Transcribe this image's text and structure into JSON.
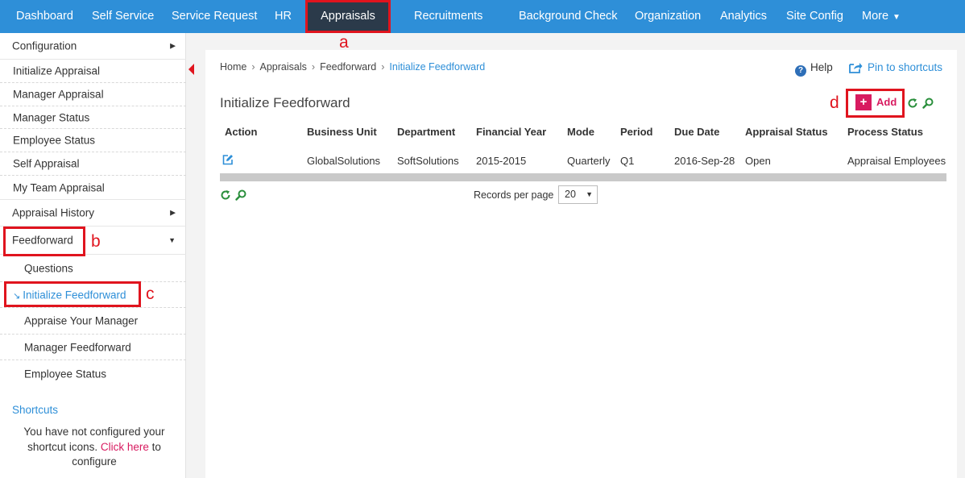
{
  "nav": {
    "items": [
      "Dashboard",
      "Self Service",
      "Service Request",
      "HR",
      "Appraisals",
      "Recruitments",
      "Background Check",
      "Organization",
      "Analytics",
      "Site Config",
      "More"
    ],
    "active": "Appraisals",
    "more_caret": "▼"
  },
  "annotations": {
    "a": "a",
    "b": "b",
    "c": "c",
    "d": "d"
  },
  "sidebar": {
    "items": [
      {
        "label": "Configuration",
        "arrow": "▶"
      },
      {
        "label": "Initialize Appraisal"
      },
      {
        "label": "Manager Appraisal"
      },
      {
        "label": "Manager Status"
      },
      {
        "label": "Employee Status"
      },
      {
        "label": "Self Appraisal"
      },
      {
        "label": "My Team Appraisal"
      },
      {
        "label": "Appraisal History",
        "arrow": "▶"
      },
      {
        "label": "Feedforward",
        "arrow": "▼"
      },
      {
        "label": "Questions"
      },
      {
        "label": "Initialize Feedforward",
        "icon": "↘"
      },
      {
        "label": "Appraise Your Manager"
      },
      {
        "label": "Manager Feedforward"
      },
      {
        "label": "Employee Status"
      }
    ],
    "shortcuts_title": "Shortcuts",
    "shortcuts_msg_before": "You have not configured your shortcut icons. ",
    "shortcuts_link": "Click here",
    "shortcuts_msg_after": " to configure"
  },
  "breadcrumb": [
    "Home",
    "Appraisals",
    "Feedforward",
    "Initialize Feedforward"
  ],
  "breadcrumb_sep": "›",
  "help_label": "Help",
  "help_icon_glyph": "?",
  "pin_label": "Pin to shortcuts",
  "page_title": "Initialize Feedforward",
  "add_label": "Add",
  "add_icon": "+",
  "table": {
    "headers": [
      "Action",
      "Business Unit",
      "Department",
      "Financial Year",
      "Mode",
      "Period",
      "Due Date",
      "Appraisal Status",
      "Process Status"
    ],
    "rows": [
      [
        "",
        "GlobalSolutions",
        "SoftSolutions",
        "2015-2015",
        "Quarterly",
        "Q1",
        "2016-Sep-28",
        "Open",
        "Appraisal Employees"
      ]
    ]
  },
  "pagination": {
    "label": "Records per page",
    "value": "20",
    "caret": "▼"
  },
  "colors": {
    "brand": "#2e8fd8",
    "nav_active": "#2b3a4a",
    "accent": "#d81b60",
    "annotation": "#e0141e"
  }
}
